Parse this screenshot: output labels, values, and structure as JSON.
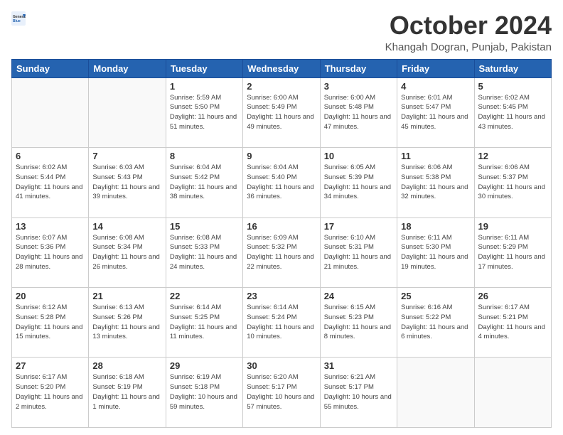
{
  "header": {
    "logo_general": "General",
    "logo_blue": "Blue",
    "title": "October 2024",
    "location": "Khangah Dogran, Punjab, Pakistan"
  },
  "days_of_week": [
    "Sunday",
    "Monday",
    "Tuesday",
    "Wednesday",
    "Thursday",
    "Friday",
    "Saturday"
  ],
  "weeks": [
    [
      {
        "day": "",
        "info": ""
      },
      {
        "day": "",
        "info": ""
      },
      {
        "day": "1",
        "info": "Sunrise: 5:59 AM\nSunset: 5:50 PM\nDaylight: 11 hours and 51 minutes."
      },
      {
        "day": "2",
        "info": "Sunrise: 6:00 AM\nSunset: 5:49 PM\nDaylight: 11 hours and 49 minutes."
      },
      {
        "day": "3",
        "info": "Sunrise: 6:00 AM\nSunset: 5:48 PM\nDaylight: 11 hours and 47 minutes."
      },
      {
        "day": "4",
        "info": "Sunrise: 6:01 AM\nSunset: 5:47 PM\nDaylight: 11 hours and 45 minutes."
      },
      {
        "day": "5",
        "info": "Sunrise: 6:02 AM\nSunset: 5:45 PM\nDaylight: 11 hours and 43 minutes."
      }
    ],
    [
      {
        "day": "6",
        "info": "Sunrise: 6:02 AM\nSunset: 5:44 PM\nDaylight: 11 hours and 41 minutes."
      },
      {
        "day": "7",
        "info": "Sunrise: 6:03 AM\nSunset: 5:43 PM\nDaylight: 11 hours and 39 minutes."
      },
      {
        "day": "8",
        "info": "Sunrise: 6:04 AM\nSunset: 5:42 PM\nDaylight: 11 hours and 38 minutes."
      },
      {
        "day": "9",
        "info": "Sunrise: 6:04 AM\nSunset: 5:40 PM\nDaylight: 11 hours and 36 minutes."
      },
      {
        "day": "10",
        "info": "Sunrise: 6:05 AM\nSunset: 5:39 PM\nDaylight: 11 hours and 34 minutes."
      },
      {
        "day": "11",
        "info": "Sunrise: 6:06 AM\nSunset: 5:38 PM\nDaylight: 11 hours and 32 minutes."
      },
      {
        "day": "12",
        "info": "Sunrise: 6:06 AM\nSunset: 5:37 PM\nDaylight: 11 hours and 30 minutes."
      }
    ],
    [
      {
        "day": "13",
        "info": "Sunrise: 6:07 AM\nSunset: 5:36 PM\nDaylight: 11 hours and 28 minutes."
      },
      {
        "day": "14",
        "info": "Sunrise: 6:08 AM\nSunset: 5:34 PM\nDaylight: 11 hours and 26 minutes."
      },
      {
        "day": "15",
        "info": "Sunrise: 6:08 AM\nSunset: 5:33 PM\nDaylight: 11 hours and 24 minutes."
      },
      {
        "day": "16",
        "info": "Sunrise: 6:09 AM\nSunset: 5:32 PM\nDaylight: 11 hours and 22 minutes."
      },
      {
        "day": "17",
        "info": "Sunrise: 6:10 AM\nSunset: 5:31 PM\nDaylight: 11 hours and 21 minutes."
      },
      {
        "day": "18",
        "info": "Sunrise: 6:11 AM\nSunset: 5:30 PM\nDaylight: 11 hours and 19 minutes."
      },
      {
        "day": "19",
        "info": "Sunrise: 6:11 AM\nSunset: 5:29 PM\nDaylight: 11 hours and 17 minutes."
      }
    ],
    [
      {
        "day": "20",
        "info": "Sunrise: 6:12 AM\nSunset: 5:28 PM\nDaylight: 11 hours and 15 minutes."
      },
      {
        "day": "21",
        "info": "Sunrise: 6:13 AM\nSunset: 5:26 PM\nDaylight: 11 hours and 13 minutes."
      },
      {
        "day": "22",
        "info": "Sunrise: 6:14 AM\nSunset: 5:25 PM\nDaylight: 11 hours and 11 minutes."
      },
      {
        "day": "23",
        "info": "Sunrise: 6:14 AM\nSunset: 5:24 PM\nDaylight: 11 hours and 10 minutes."
      },
      {
        "day": "24",
        "info": "Sunrise: 6:15 AM\nSunset: 5:23 PM\nDaylight: 11 hours and 8 minutes."
      },
      {
        "day": "25",
        "info": "Sunrise: 6:16 AM\nSunset: 5:22 PM\nDaylight: 11 hours and 6 minutes."
      },
      {
        "day": "26",
        "info": "Sunrise: 6:17 AM\nSunset: 5:21 PM\nDaylight: 11 hours and 4 minutes."
      }
    ],
    [
      {
        "day": "27",
        "info": "Sunrise: 6:17 AM\nSunset: 5:20 PM\nDaylight: 11 hours and 2 minutes."
      },
      {
        "day": "28",
        "info": "Sunrise: 6:18 AM\nSunset: 5:19 PM\nDaylight: 11 hours and 1 minute."
      },
      {
        "day": "29",
        "info": "Sunrise: 6:19 AM\nSunset: 5:18 PM\nDaylight: 10 hours and 59 minutes."
      },
      {
        "day": "30",
        "info": "Sunrise: 6:20 AM\nSunset: 5:17 PM\nDaylight: 10 hours and 57 minutes."
      },
      {
        "day": "31",
        "info": "Sunrise: 6:21 AM\nSunset: 5:17 PM\nDaylight: 10 hours and 55 minutes."
      },
      {
        "day": "",
        "info": ""
      },
      {
        "day": "",
        "info": ""
      }
    ]
  ]
}
